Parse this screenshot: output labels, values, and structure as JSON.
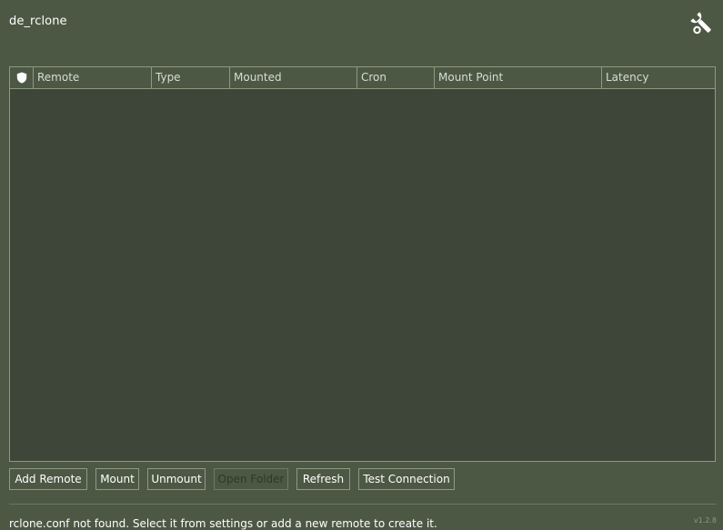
{
  "window": {
    "title": "de_rclone"
  },
  "settings": {
    "icon": "wrench-icon"
  },
  "table": {
    "status_icon": "shield-icon",
    "columns": [
      "Remote",
      "Type",
      "Mounted",
      "Cron",
      "Mount Point",
      "Latency"
    ],
    "rows": []
  },
  "toolbar": {
    "add_remote": "Add Remote",
    "mount": "Mount",
    "unmount": "Unmount",
    "open_folder": "Open Folder",
    "refresh": "Refresh",
    "test_connection": "Test Connection"
  },
  "status": {
    "message": "rclone.conf not found. Select it from settings or add a new remote to create it.",
    "version": "v1.2.8"
  },
  "colors": {
    "background": "#4c5844",
    "table_background": "#3e4639",
    "border": "#8c9a84"
  }
}
